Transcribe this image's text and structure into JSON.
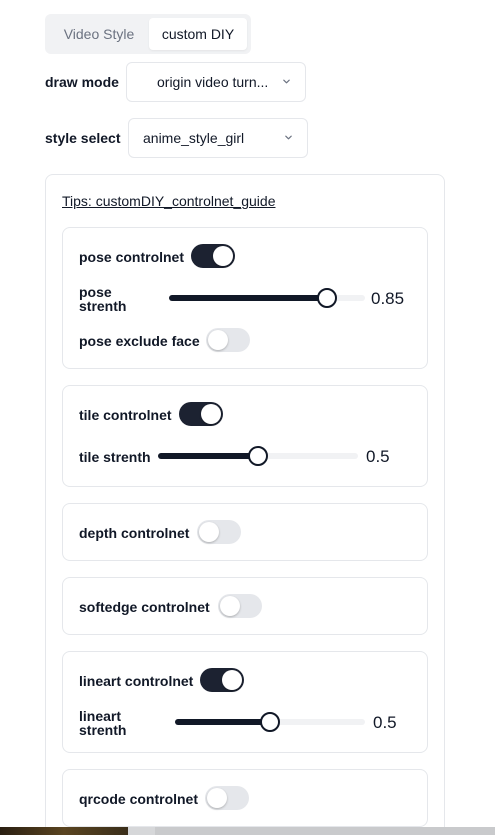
{
  "tabs": [
    {
      "label": "Video Style",
      "active": false
    },
    {
      "label": "custom DIY",
      "active": true
    }
  ],
  "draw_mode": {
    "label": "draw mode",
    "value": "origin video turn..."
  },
  "style_select": {
    "label": "style select",
    "value": "anime_style_girl"
  },
  "tips": {
    "text": "Tips: customDIY_controlnet_guide"
  },
  "controls": {
    "pose": {
      "label": "pose controlnet",
      "enabled": true,
      "strength_label_1": "pose",
      "strength_label_2": "strenth",
      "strength_value": "0.85",
      "exclude_face_label": "pose exclude face",
      "exclude_face_enabled": false
    },
    "tile": {
      "label": "tile controlnet",
      "enabled": true,
      "strength_label": "tile strenth",
      "strength_value": "0.5"
    },
    "depth": {
      "label": "depth controlnet",
      "enabled": false
    },
    "softedge": {
      "label": "softedge controlnet",
      "enabled": false
    },
    "lineart": {
      "label": "lineart controlnet",
      "enabled": true,
      "strength_label_1": "lineart",
      "strength_label_2": "strenth",
      "strength_value": "0.5"
    },
    "qrcode": {
      "label": "qrcode controlnet",
      "enabled": false
    }
  },
  "icons": {
    "dropdown": "chevron-down-icon"
  },
  "colors": {
    "accent": "#1c2231",
    "track": "#f1f2f4",
    "border": "#e5e7eb"
  }
}
